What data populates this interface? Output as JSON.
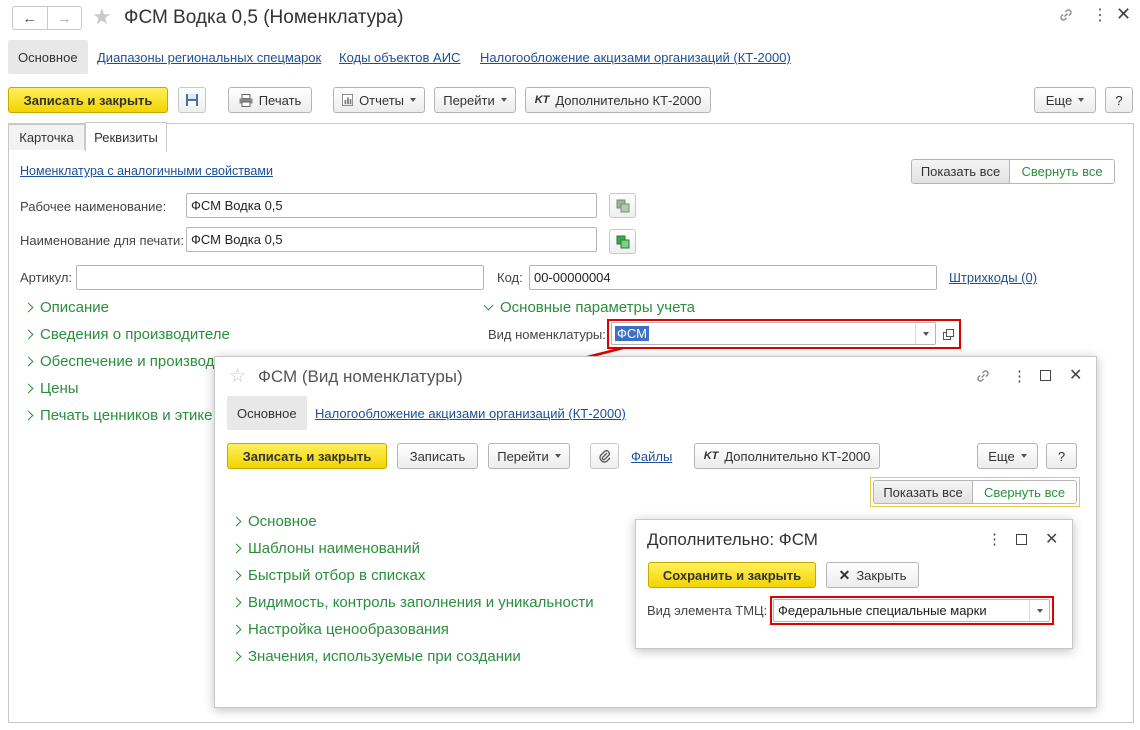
{
  "window": {
    "title": "ФСМ Водка 0,5 (Номенклатура)",
    "tabs": [
      "Основное",
      "Диапазоны региональных спецмарок",
      "Коды объектов АИС",
      "Налогообложение акцизами организаций (КТ-2000)"
    ]
  },
  "toolbar": {
    "save_close": "Записать и закрыть",
    "print": "Печать",
    "reports": "Отчеты",
    "goto": "Перейти",
    "extra": "Дополнительно КТ-2000",
    "more": "Еще",
    "help": "?"
  },
  "subtabs": [
    "Карточка",
    "Реквизиты"
  ],
  "form": {
    "similar_link": "Номенклатура с аналогичными свойствами",
    "show_all": "Показать все",
    "collapse_all": "Свернуть все",
    "work_name_label": "Рабочее наименование:",
    "work_name_value": "ФСМ Водка 0,5",
    "print_name_label": "Наименование для печати:",
    "print_name_value": "ФСМ Водка 0,5",
    "article_label": "Артикул:",
    "article_value": "",
    "code_label": "Код:",
    "code_value": "00-00000004",
    "barcodes_link": "Штрихкоды (0)",
    "sections_left": [
      "Описание",
      "Сведения о производителе",
      "Обеспечение и производ",
      "Цены",
      "Печать ценников и этике"
    ],
    "section_right": "Основные параметры учета",
    "kind_label": "Вид номенклатуры:",
    "kind_value": "ФСМ"
  },
  "kind_window": {
    "title": "ФСМ (Вид номенклатуры)",
    "tabs": [
      "Основное",
      "Налогообложение акцизами организаций (КТ-2000)"
    ],
    "save_close": "Записать и закрыть",
    "save": "Записать",
    "goto": "Перейти",
    "files": "Файлы",
    "extra": "Дополнительно КТ-2000",
    "more": "Еще",
    "help": "?",
    "show_all": "Показать все",
    "collapse_all": "Свернуть все",
    "sections": [
      "Основное",
      "Шаблоны наименований",
      "Быстрый отбор в списках",
      "Видимость, контроль заполнения и уникальности",
      "Настройка ценообразования",
      "Значения, используемые при создании"
    ]
  },
  "extra_window": {
    "title": "Дополнительно: ФСМ",
    "save_close": "Сохранить и закрыть",
    "close": "Закрыть",
    "tmc_label": "Вид элемента ТМЦ:",
    "tmc_value": "Федеральные специальные марки"
  },
  "colors": {
    "accent_yellow": "#f5d90a",
    "highlight_red": "#e00000",
    "link_blue": "#1b4f9c",
    "section_green": "#2a8f3c",
    "selection_blue": "#3d6fc4"
  }
}
